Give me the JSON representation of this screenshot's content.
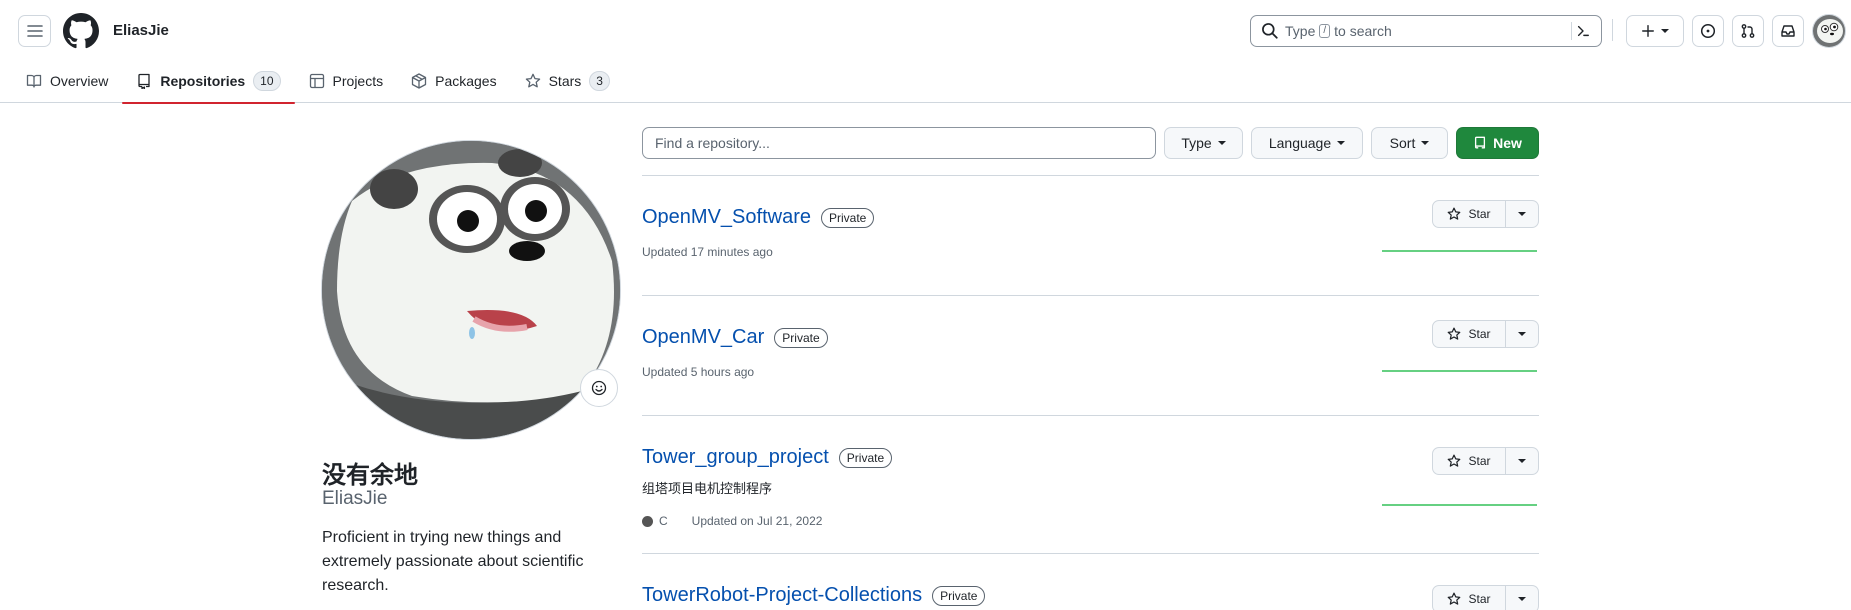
{
  "header": {
    "username": "EliasJie",
    "search": {
      "prefix": "Type",
      "key": "/",
      "suffix": "to search"
    }
  },
  "tabs": [
    {
      "label": "Overview",
      "count": null,
      "icon": "book-icon"
    },
    {
      "label": "Repositories",
      "count": "10",
      "icon": "repo-icon",
      "active": true
    },
    {
      "label": "Projects",
      "count": null,
      "icon": "table-icon"
    },
    {
      "label": "Packages",
      "count": null,
      "icon": "package-icon"
    },
    {
      "label": "Stars",
      "count": "3",
      "icon": "star-icon"
    }
  ],
  "profile": {
    "display_name": "没有余地",
    "login": "EliasJie",
    "bio": "Proficient in trying new things and extremely passionate about scientific research."
  },
  "toolbar": {
    "find_placeholder": "Find a repository...",
    "type_label": "Type",
    "language_label": "Language",
    "sort_label": "Sort",
    "new_label": "New"
  },
  "repos": [
    {
      "name": "OpenMV_Software",
      "visibility": "Private",
      "description": "",
      "language": "",
      "updated": "Updated 17 minutes ago",
      "star_label": "Star"
    },
    {
      "name": "OpenMV_Car",
      "visibility": "Private",
      "description": "",
      "language": "",
      "updated": "Updated 5 hours ago",
      "star_label": "Star"
    },
    {
      "name": "Tower_group_project",
      "visibility": "Private",
      "description": "组塔项目电机控制程序",
      "language": "C",
      "updated": "Updated on Jul 21, 2022",
      "star_label": "Star"
    },
    {
      "name": "TowerRobot-Project-Collections",
      "visibility": "Private",
      "description": "",
      "language": "",
      "updated": "",
      "star_label": "Star"
    }
  ],
  "colors": {
    "accent_green": "#1f883d",
    "link": "#0550ae",
    "tab_underline": "#d1242f",
    "lang_c": "#555555"
  }
}
